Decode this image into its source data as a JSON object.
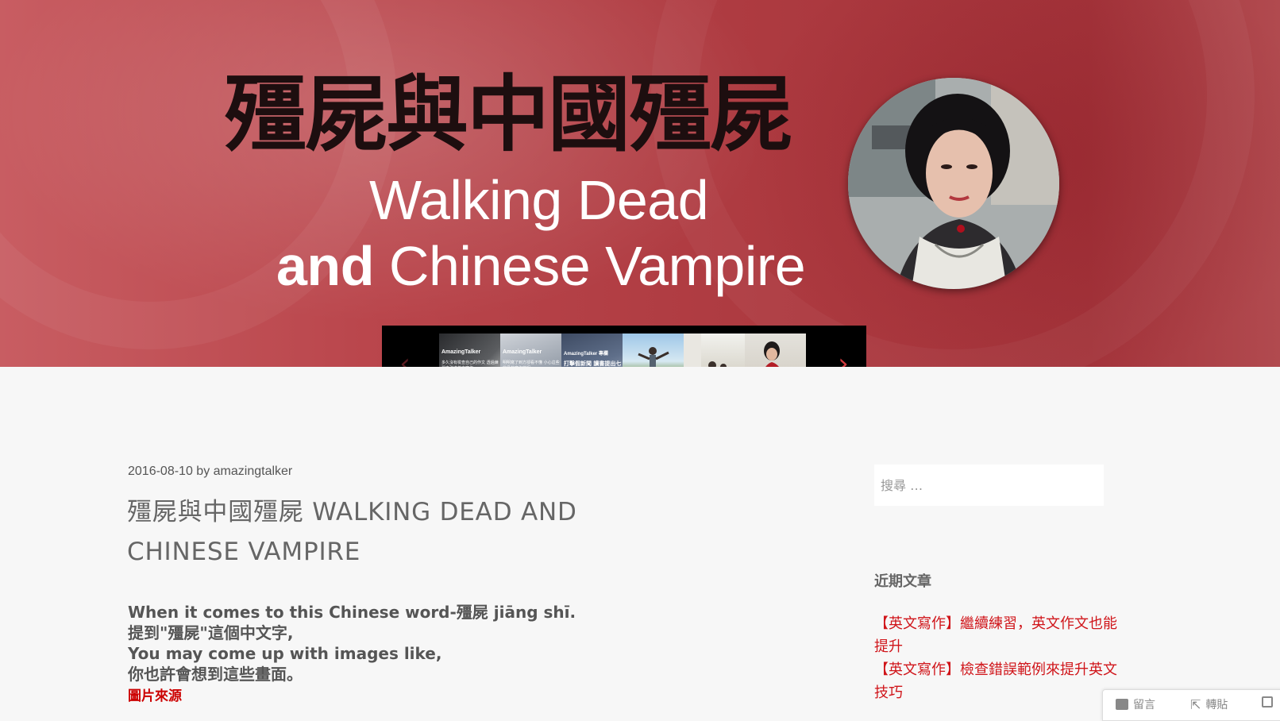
{
  "banner": {
    "title_cn": "殭屍與中國殭屍",
    "title_en_line1": "Walking Dead",
    "title_en_line2_bold": "and",
    "title_en_line2_rest": "Chinese Vampire"
  },
  "carousel": {
    "prev_icon": "chevron-left-icon",
    "next_icon": "chevron-right-icon",
    "thumbnails": [
      {
        "title": "AmazingTalker",
        "sub": "多久沒有檢查自己的作文 透過練習來改進英文寫作"
      },
      {
        "title": "AmazingTalker",
        "sub": "明明寫了到方卻看不懂 小心這些常見的寫作錯誤"
      },
      {
        "title": "AmazingTalker 專欄",
        "sub": "打擊假新聞 讀書提出七項對策"
      },
      {
        "title": "",
        "sub": ""
      },
      {
        "title": "",
        "sub": ""
      },
      {
        "title": "",
        "sub": ""
      }
    ]
  },
  "post": {
    "date": "2016-08-10",
    "by": "by",
    "author": "amazingtalker",
    "title": "殭屍與中國殭屍 WALKING DEAD AND CHINESE VAMPIRE",
    "lines": [
      "When it comes to this Chinese word-殭屍 jiāng shī.",
      "提到\"殭屍\"這個中文字,",
      "You may come up with images like,",
      "你也許會想到這些畫面。"
    ],
    "source_link": "圖片來源"
  },
  "sidebar": {
    "search_placeholder": "搜尋 …",
    "recent_heading": "近期文章",
    "recent_posts": [
      "【英文寫作】繼續練習，英文作文也能提升",
      "【英文寫作】檢查錯誤範例來提升英文技巧"
    ]
  },
  "float_bar": {
    "comment_label": "留言",
    "reblog_label": "轉貼"
  },
  "colors": {
    "banner_red": "#b1434a",
    "link_red": "#d0151a",
    "carousel_bg": "#000000"
  }
}
